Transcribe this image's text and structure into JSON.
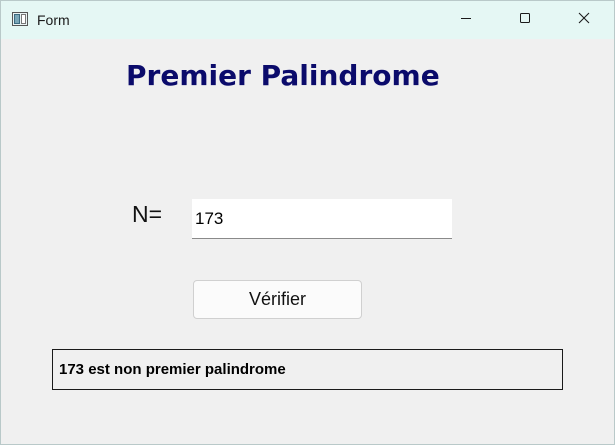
{
  "window": {
    "title": "Form",
    "icons": {
      "app": "app-window-icon",
      "minimize": "minimize-icon",
      "maximize": "maximize-icon",
      "close": "close-icon"
    }
  },
  "form": {
    "heading": "Premier Palindrome",
    "n_label": "N=",
    "n_value": "173",
    "verify_label": "Vérifier",
    "result": "173 est non premier palindrome"
  },
  "colors": {
    "heading": "#0b0b6b",
    "titlebar": "#e5f7f4",
    "window_bg": "#f0f0f0"
  }
}
